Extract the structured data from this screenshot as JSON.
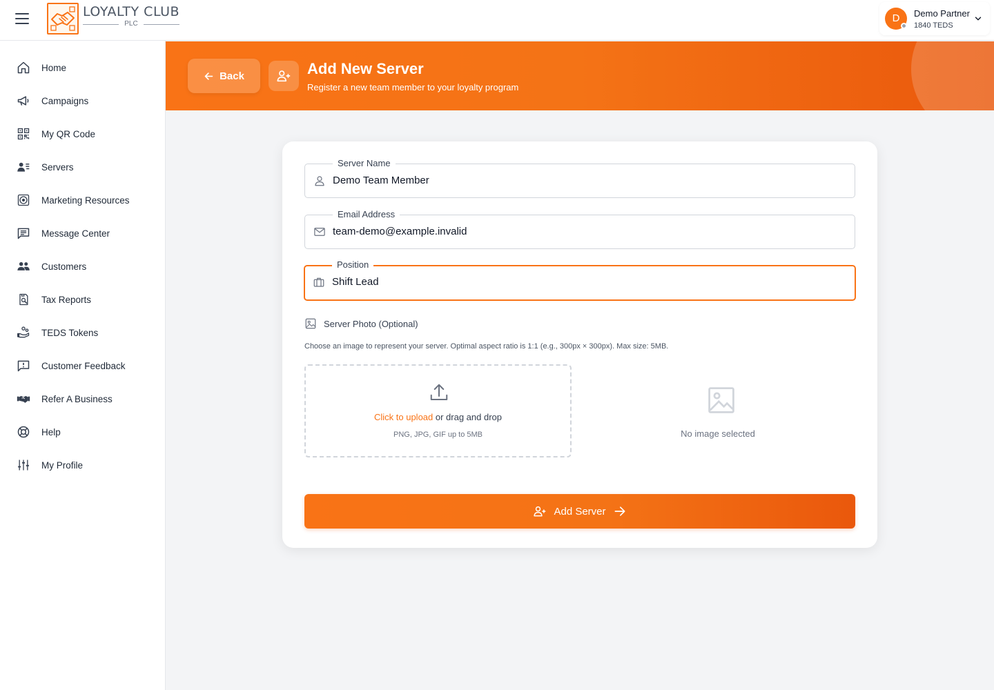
{
  "brand": {
    "name": "LOYALTY CLUB",
    "sub": "PLC"
  },
  "user": {
    "initial": "D",
    "name": "Demo Partner",
    "points": "1840 TEDS"
  },
  "sidebar": {
    "items": [
      {
        "label": "Home",
        "icon": "home-icon"
      },
      {
        "label": "Campaigns",
        "icon": "megaphone-icon"
      },
      {
        "label": "My QR Code",
        "icon": "qr-code-icon"
      },
      {
        "label": "Servers",
        "icon": "servers-icon"
      },
      {
        "label": "Marketing Resources",
        "icon": "target-icon"
      },
      {
        "label": "Message Center",
        "icon": "message-icon"
      },
      {
        "label": "Customers",
        "icon": "customers-icon"
      },
      {
        "label": "Tax Reports",
        "icon": "tax-report-icon"
      },
      {
        "label": "TEDS Tokens",
        "icon": "tokens-icon"
      },
      {
        "label": "Customer Feedback",
        "icon": "feedback-icon"
      },
      {
        "label": "Refer A Business",
        "icon": "handshake-icon"
      },
      {
        "label": "Help",
        "icon": "lifebuoy-icon"
      },
      {
        "label": "My Profile",
        "icon": "sliders-icon"
      }
    ]
  },
  "header": {
    "back_label": "Back",
    "title": "Add New Server",
    "subtitle": "Register a new team member to your loyalty program"
  },
  "form": {
    "name_label": "Server Name",
    "name_value": "Demo Team Member",
    "email_label": "Email Address",
    "email_value": "team-demo@example.invalid",
    "position_label": "Position",
    "position_value": "Shift Lead",
    "photo_label": "Server Photo (Optional)",
    "photo_help": "Choose an image to represent your server. Optimal aspect ratio is 1:1 (e.g., 300px × 300px). Max size: 5MB.",
    "upload_link": "Click to upload",
    "upload_rest": " or drag and drop",
    "upload_types": "PNG, JPG, GIF up to 5MB",
    "preview_empty": "No image selected",
    "submit_label": "Add Server"
  },
  "colors": {
    "accent": "#f97316",
    "accent_dark": "#ea580c"
  }
}
